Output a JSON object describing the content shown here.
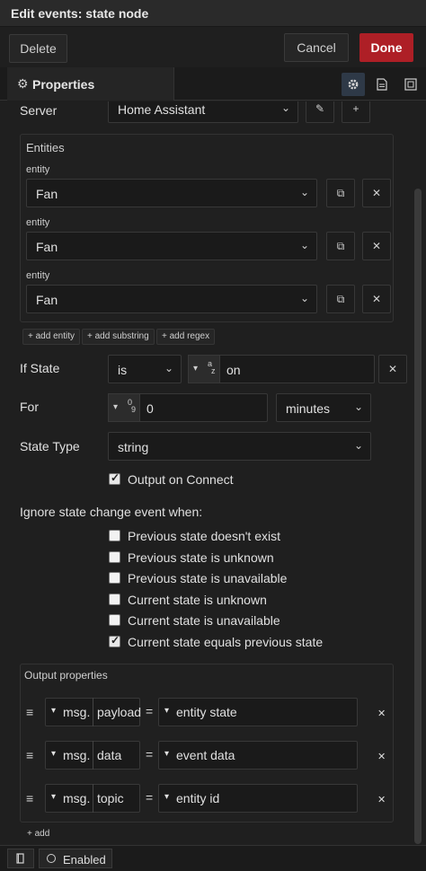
{
  "titlebar": {
    "title": "Edit events: state node"
  },
  "actions": {
    "delete": "Delete",
    "cancel": "Cancel",
    "done": "Done"
  },
  "tabs": {
    "properties": "Properties",
    "gear_icon": "gear-icon",
    "doc_icon": "document-icon",
    "frame_icon": "frame-icon"
  },
  "server": {
    "label": "Server",
    "value": "Home Assistant"
  },
  "entities": {
    "title": "Entities",
    "items": [
      {
        "label": "entity",
        "value": "Fan"
      },
      {
        "label": "entity",
        "value": "Fan"
      },
      {
        "label": "entity",
        "value": "Fan"
      }
    ],
    "add_entity": "add entity",
    "add_substring": "add substring",
    "add_regex": "add regex"
  },
  "if_state": {
    "label": "If State",
    "operator": "is",
    "type_glyph": "a",
    "type_sub": "z",
    "value": "on"
  },
  "for": {
    "label": "For",
    "type_glyph": "0",
    "type_sub": "9",
    "value": "0",
    "unit": "minutes"
  },
  "state_type": {
    "label": "State Type",
    "value": "string"
  },
  "output_on_connect": {
    "label": "Output on Connect",
    "checked": true
  },
  "ignore": {
    "title": "Ignore state change event when:",
    "options": [
      {
        "label": "Previous state doesn't exist",
        "checked": false
      },
      {
        "label": "Previous state is unknown",
        "checked": false
      },
      {
        "label": "Previous state is unavailable",
        "checked": false
      },
      {
        "label": "Current state is unknown",
        "checked": false
      },
      {
        "label": "Current state is unavailable",
        "checked": false
      },
      {
        "label": "Current state equals previous state",
        "checked": true
      }
    ]
  },
  "output_props": {
    "title": "Output properties",
    "rows": [
      {
        "prefix": "msg.",
        "name": "payload",
        "eq": "=",
        "value": "entity state"
      },
      {
        "prefix": "msg.",
        "name": "data",
        "eq": "=",
        "value": "event data"
      },
      {
        "prefix": "msg.",
        "name": "topic",
        "eq": "=",
        "value": "entity id"
      }
    ],
    "add": "add"
  },
  "footer": {
    "enabled": "Enabled"
  }
}
